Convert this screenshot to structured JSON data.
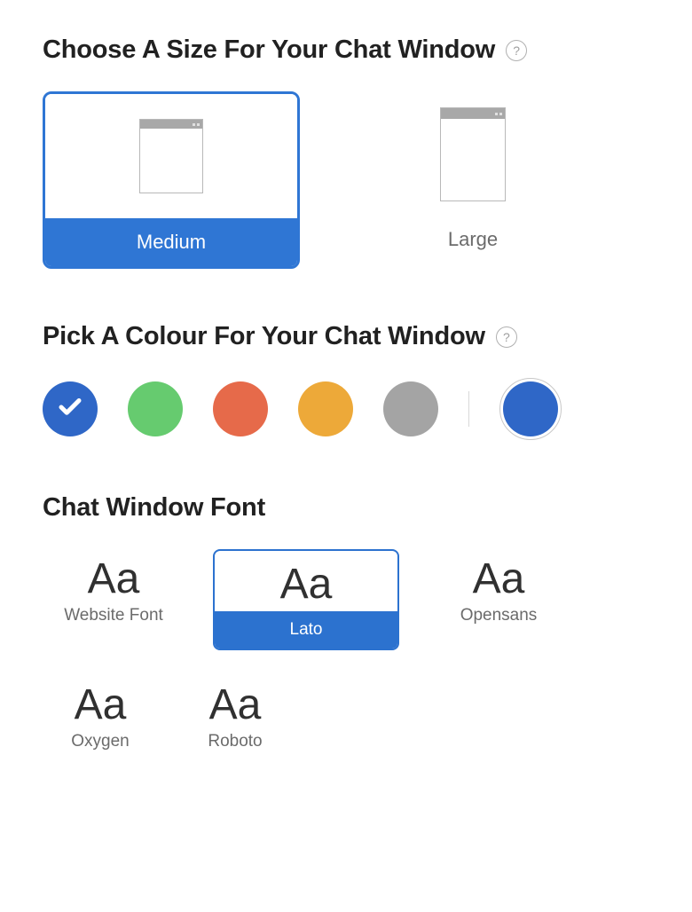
{
  "size_section": {
    "title": "Choose A Size For Your Chat Window",
    "options": [
      {
        "label": "Medium",
        "selected": true
      },
      {
        "label": "Large",
        "selected": false
      }
    ]
  },
  "colour_section": {
    "title": "Pick A Colour For Your Chat Window",
    "swatches": [
      {
        "name": "blue",
        "hex": "#2f67c7",
        "selected": true
      },
      {
        "name": "green",
        "hex": "#66cb6f",
        "selected": false
      },
      {
        "name": "orange",
        "hex": "#e66a4a",
        "selected": false
      },
      {
        "name": "amber",
        "hex": "#eda939",
        "selected": false
      },
      {
        "name": "grey",
        "hex": "#a4a4a4",
        "selected": false
      }
    ],
    "custom": {
      "hex": "#2f67c7"
    }
  },
  "font_section": {
    "title": "Chat Window Font",
    "sample_text": "Aa",
    "options": [
      {
        "label": "Website Font",
        "selected": false
      },
      {
        "label": "Lato",
        "selected": true
      },
      {
        "label": "Opensans",
        "selected": false
      },
      {
        "label": "Oxygen",
        "selected": false
      },
      {
        "label": "Roboto",
        "selected": false
      }
    ]
  }
}
